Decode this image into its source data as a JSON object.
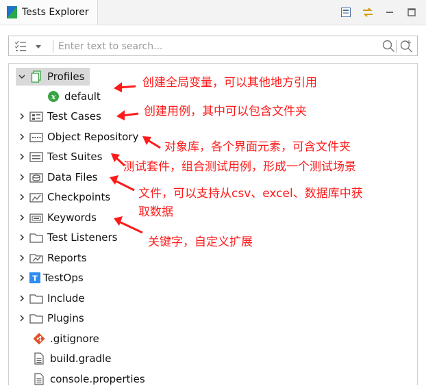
{
  "tab": {
    "title": "Tests Explorer"
  },
  "search": {
    "placeholder": "Enter text to search..."
  },
  "tree": {
    "items": [
      {
        "label": "Profiles"
      },
      {
        "label": "default"
      },
      {
        "label": "Test Cases"
      },
      {
        "label": "Object Repository"
      },
      {
        "label": "Test Suites"
      },
      {
        "label": "Data Files"
      },
      {
        "label": "Checkpoints"
      },
      {
        "label": "Keywords"
      },
      {
        "label": "Test Listeners"
      },
      {
        "label": "Reports"
      },
      {
        "label": "TestOps"
      },
      {
        "label": "Include"
      },
      {
        "label": "Plugins"
      },
      {
        "label": ".gitignore"
      },
      {
        "label": "build.gradle"
      },
      {
        "label": "console.properties"
      }
    ]
  },
  "annotations": {
    "profiles": "创建全局变量，可以其他地方引用",
    "test_cases": "创建用例，其中可以包含文件夹",
    "object_repository": "对象库，各个界面元素，可含文件夹",
    "test_suites": "测试套件，组合测试用例，形成一个测试场景",
    "data_files_line1": "文件，可以支持从csv、excel、数据库中获",
    "data_files_line2": "取数据",
    "keywords": "关键字，自定义扩展"
  },
  "colors": {
    "annotation": "#ff1a1a",
    "selection": "#d9d9d9",
    "folder": "#5c5c5c",
    "profile_icon": "#3aa346",
    "testops_icon": "#2d8cf0",
    "git_icon": "#e0522b"
  }
}
